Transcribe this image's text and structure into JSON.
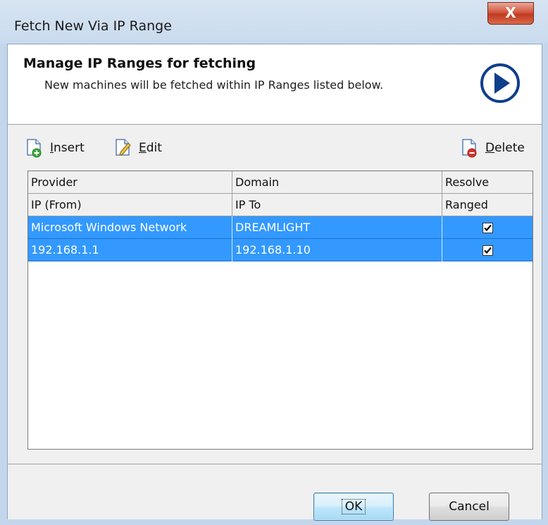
{
  "window": {
    "title": "Fetch New Via IP Range",
    "close_label": "X"
  },
  "header": {
    "title": "Manage IP Ranges for fetching",
    "subtitle": "New machines will be fetched within IP Ranges listed below."
  },
  "toolbar": {
    "insert_label": "Insert",
    "edit_label": "Edit",
    "delete_label": "Delete"
  },
  "grid": {
    "header_rows": [
      [
        "Provider",
        "Domain",
        "Resolve"
      ],
      [
        "IP (From)",
        "IP To",
        "Ranged"
      ]
    ],
    "rows": [
      {
        "col1": "Microsoft Windows Network",
        "col2": "DREAMLIGHT",
        "checked": true
      },
      {
        "col1": "192.168.1.1",
        "col2": "192.168.1.10",
        "checked": true
      }
    ]
  },
  "buttons": {
    "ok_label": "OK",
    "cancel_label": "Cancel"
  },
  "colors": {
    "selection": "#3399ff",
    "accent_icon": "#0f3e8c"
  }
}
